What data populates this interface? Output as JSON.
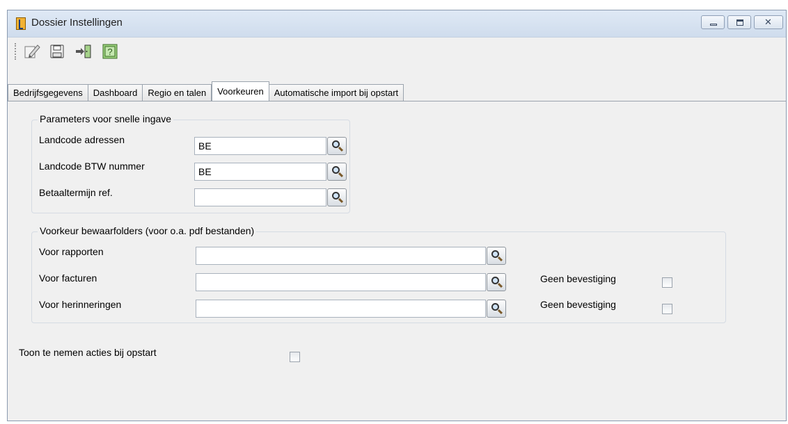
{
  "window": {
    "title": "Dossier Instellingen"
  },
  "toolbar": {
    "items": [
      {
        "icon": "edit-icon"
      },
      {
        "icon": "save-icon"
      },
      {
        "icon": "exit-icon"
      },
      {
        "icon": "help-icon"
      }
    ]
  },
  "tabs": [
    {
      "label": "Bedrijfsgegevens",
      "active": false
    },
    {
      "label": "Dashboard",
      "active": false
    },
    {
      "label": "Regio en talen",
      "active": false
    },
    {
      "label": "Voorkeuren",
      "active": true
    },
    {
      "label": "Automatische import bij opstart",
      "active": false
    }
  ],
  "quick_entry": {
    "legend": "Parameters voor snelle ingave",
    "country_addresses": {
      "label": "Landcode adressen",
      "value": "BE"
    },
    "country_vat": {
      "label": "Landcode BTW nummer",
      "value": "BE"
    },
    "payment_term": {
      "label": "Betaaltermijn ref.",
      "value": ""
    }
  },
  "folders": {
    "legend": "Voorkeur bewaarfolders (voor o.a. pdf bestanden)",
    "reports": {
      "label": "Voor rapporten",
      "value": ""
    },
    "invoices": {
      "label": "Voor facturen",
      "value": "",
      "confirm_label": "Geen bevestiging",
      "confirm_checked": false
    },
    "reminders": {
      "label": "Voor herinneringen",
      "value": "",
      "confirm_label": "Geen bevestiging",
      "confirm_checked": false
    }
  },
  "startup_actions": {
    "label": "Toon te nemen acties bij opstart",
    "checked": false
  }
}
